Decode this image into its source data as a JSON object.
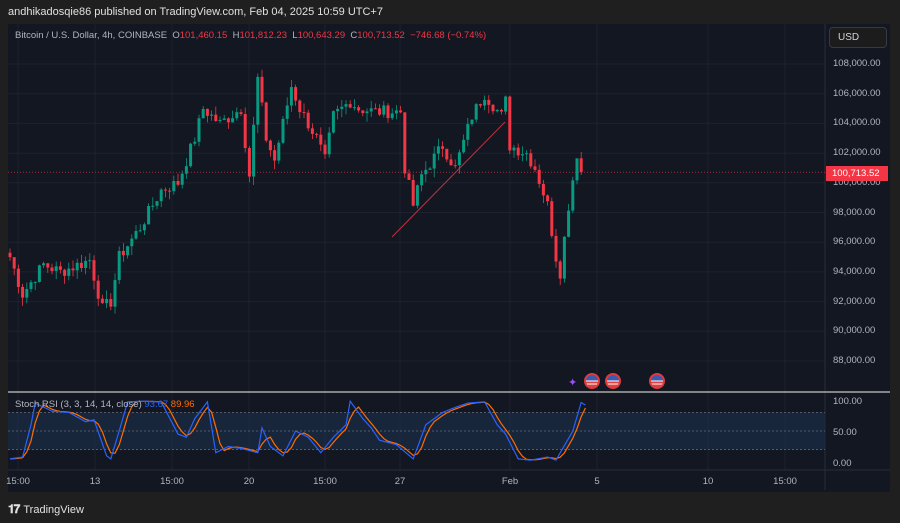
{
  "publisher": "andhikadosqie86 published on TradingView.com, Feb 04, 2025 10:59 UTC+7",
  "legend": {
    "symbol": "Bitcoin / U.S. Dollar, 4h, COINBASE",
    "o_label": "O",
    "o": "101,460.15",
    "h_label": "H",
    "h": "101,812.23",
    "l_label": "L",
    "l": "100,643.29",
    "c_label": "C",
    "c": "100,713.52",
    "change": "−746.68 (−0.74%)"
  },
  "currency": "USD",
  "last_price": "100,713.52",
  "price_axis": [
    "108,000.00",
    "106,000.00",
    "104,000.00",
    "102,000.00",
    "100,000.00",
    "98,000.00",
    "96,000.00",
    "94,000.00",
    "92,000.00",
    "90,000.00",
    "88,000.00"
  ],
  "stoch": {
    "label": "Stoch RSI (3, 3, 14, 14, close)",
    "k": "93.67",
    "d": "89.96",
    "axis": [
      "100.00",
      "50.00",
      "0.00"
    ],
    "bands": [
      80,
      50,
      20
    ]
  },
  "time_axis": [
    "15:00",
    "13",
    "15:00",
    "20",
    "15:00",
    "27",
    "Feb",
    "5",
    "10",
    "15:00"
  ],
  "brand": "TradingView",
  "colors": {
    "up": "#089981",
    "down": "#f23645",
    "k": "#2962ff",
    "d": "#ff6d00",
    "bg": "#131722"
  },
  "chart_data": {
    "type": "candlestick",
    "ylim": [
      87000,
      109500
    ],
    "close_anchors": [
      [
        0,
        95000
      ],
      [
        3,
        92500
      ],
      [
        8,
        94500
      ],
      [
        12,
        94000
      ],
      [
        19,
        94800
      ],
      [
        22,
        91500
      ],
      [
        24,
        92000
      ],
      [
        26,
        95000
      ],
      [
        31,
        97000
      ],
      [
        36,
        99500
      ],
      [
        40,
        100000
      ],
      [
        44,
        103000
      ],
      [
        46,
        105000
      ],
      [
        50,
        104000
      ],
      [
        55,
        105000
      ],
      [
        57,
        100500
      ],
      [
        59,
        107000
      ],
      [
        61,
        103000
      ],
      [
        63,
        101500
      ],
      [
        67,
        106500
      ],
      [
        69,
        105000
      ],
      [
        73,
        103000
      ],
      [
        75,
        101500
      ],
      [
        77,
        104500
      ],
      [
        81,
        105500
      ],
      [
        83,
        105000
      ],
      [
        87,
        104800
      ],
      [
        93,
        104800
      ],
      [
        94,
        101000
      ],
      [
        96,
        98500
      ],
      [
        98,
        100500
      ],
      [
        103,
        102500
      ],
      [
        106,
        101000
      ],
      [
        110,
        104500
      ],
      [
        113,
        106000
      ],
      [
        117,
        104500
      ],
      [
        118,
        105500
      ],
      [
        119,
        102500
      ],
      [
        123,
        102000
      ],
      [
        125,
        101000
      ],
      [
        128,
        98500
      ],
      [
        130,
        95000
      ],
      [
        131,
        94000
      ],
      [
        133,
        98500
      ],
      [
        135,
        102000
      ],
      [
        136,
        100713
      ]
    ],
    "stoch_k_anchors": [
      [
        0,
        5
      ],
      [
        3,
        8
      ],
      [
        5,
        60
      ],
      [
        6,
        95
      ],
      [
        10,
        82
      ],
      [
        14,
        80
      ],
      [
        18,
        65
      ],
      [
        20,
        68
      ],
      [
        23,
        10
      ],
      [
        24,
        5
      ],
      [
        26,
        50
      ],
      [
        28,
        97
      ],
      [
        31,
        98
      ],
      [
        36,
        97
      ],
      [
        40,
        45
      ],
      [
        42,
        40
      ],
      [
        44,
        70
      ],
      [
        47,
        97
      ],
      [
        49,
        15
      ],
      [
        52,
        25
      ],
      [
        55,
        22
      ],
      [
        59,
        15
      ],
      [
        60,
        55
      ],
      [
        62,
        25
      ],
      [
        65,
        10
      ],
      [
        68,
        50
      ],
      [
        71,
        40
      ],
      [
        74,
        15
      ],
      [
        77,
        40
      ],
      [
        80,
        60
      ],
      [
        81,
        98
      ],
      [
        84,
        70
      ],
      [
        86,
        55
      ],
      [
        88,
        35
      ],
      [
        92,
        28
      ],
      [
        96,
        5
      ],
      [
        99,
        60
      ],
      [
        103,
        80
      ],
      [
        106,
        88
      ],
      [
        109,
        95
      ],
      [
        113,
        97
      ],
      [
        116,
        60
      ],
      [
        118,
        45
      ],
      [
        121,
        5
      ],
      [
        124,
        3
      ],
      [
        128,
        8
      ],
      [
        130,
        3
      ],
      [
        134,
        50
      ],
      [
        136,
        96
      ],
      [
        137,
        92
      ]
    ]
  }
}
